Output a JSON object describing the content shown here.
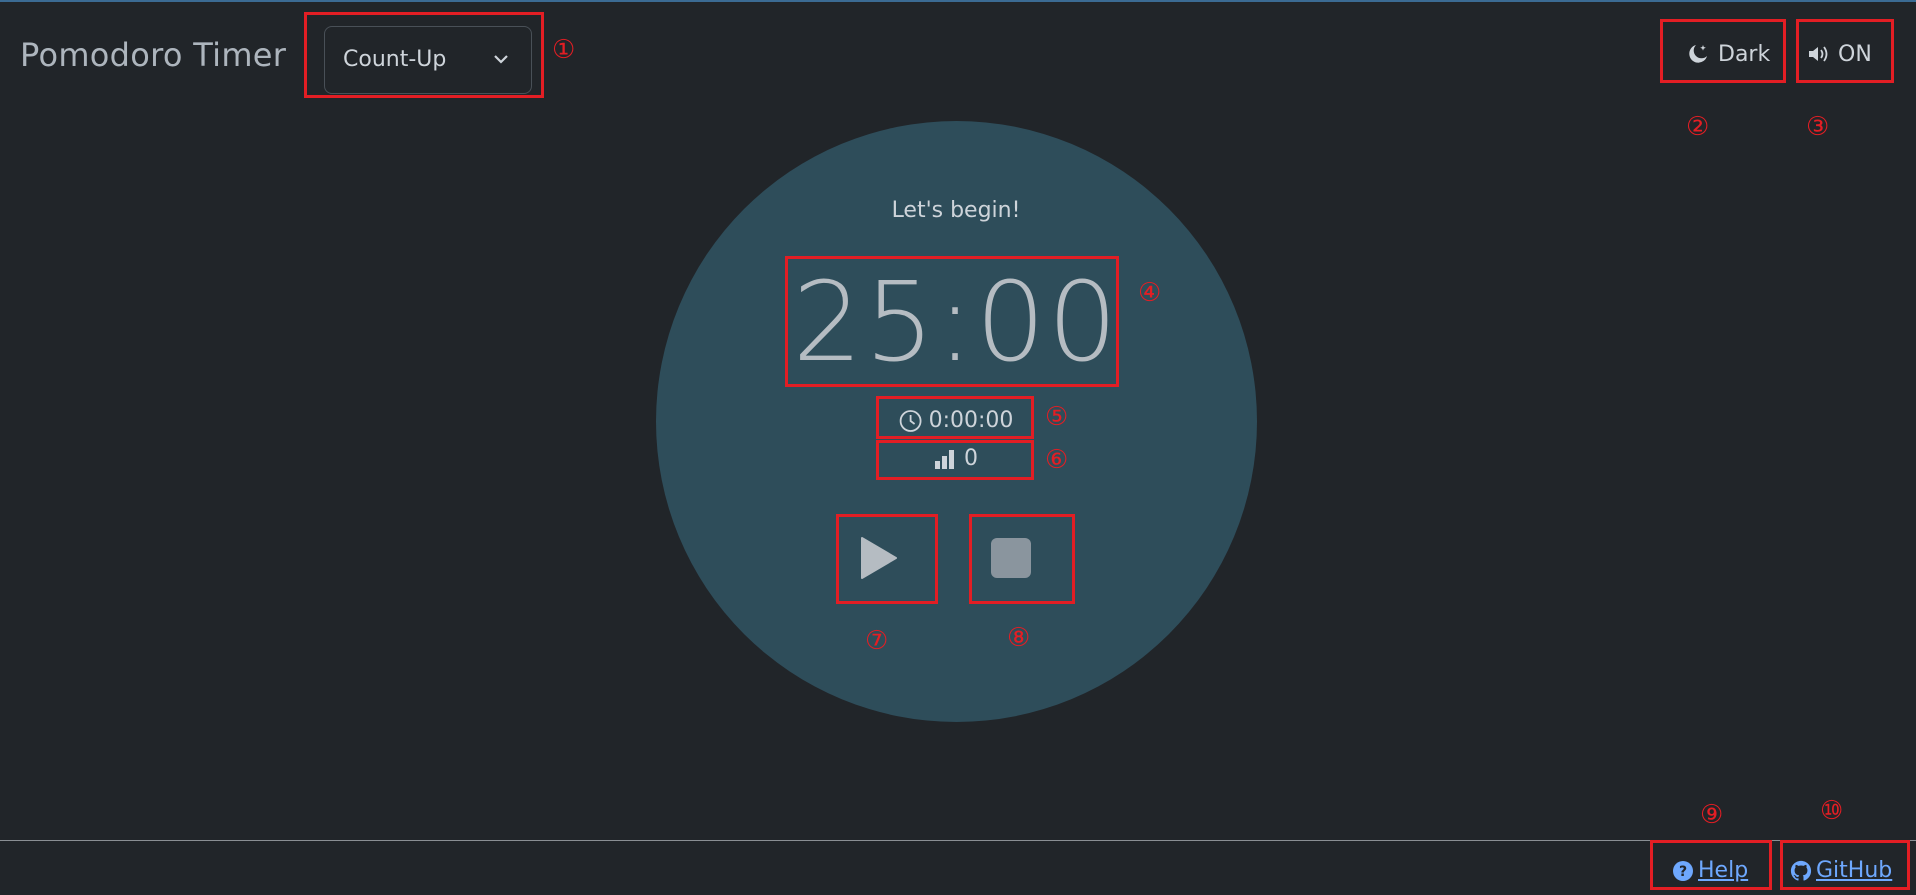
{
  "app": {
    "title": "Pomodoro Timer"
  },
  "mode_select": {
    "value": "Count-Up"
  },
  "theme_toggle": {
    "label": "Dark",
    "icon": "moon-stars-icon"
  },
  "sound_toggle": {
    "label": "ON",
    "icon": "volume-up-icon"
  },
  "timer": {
    "status": "Let's begin!",
    "time": "25:00",
    "elapsed": "0:00:00",
    "count": "0"
  },
  "controls": {
    "play_icon": "play-icon",
    "stop_icon": "stop-icon"
  },
  "footer": {
    "help": " Help",
    "github": " GitHub"
  },
  "annotations": [
    "①",
    "②",
    "③",
    "④",
    "⑤",
    "⑥",
    "⑦",
    "⑧",
    "⑨",
    "⑩"
  ],
  "colors": {
    "background": "#212529",
    "circle": "#2e4d5a",
    "link": "#6ea8fe",
    "annotation": "#e31e24"
  }
}
